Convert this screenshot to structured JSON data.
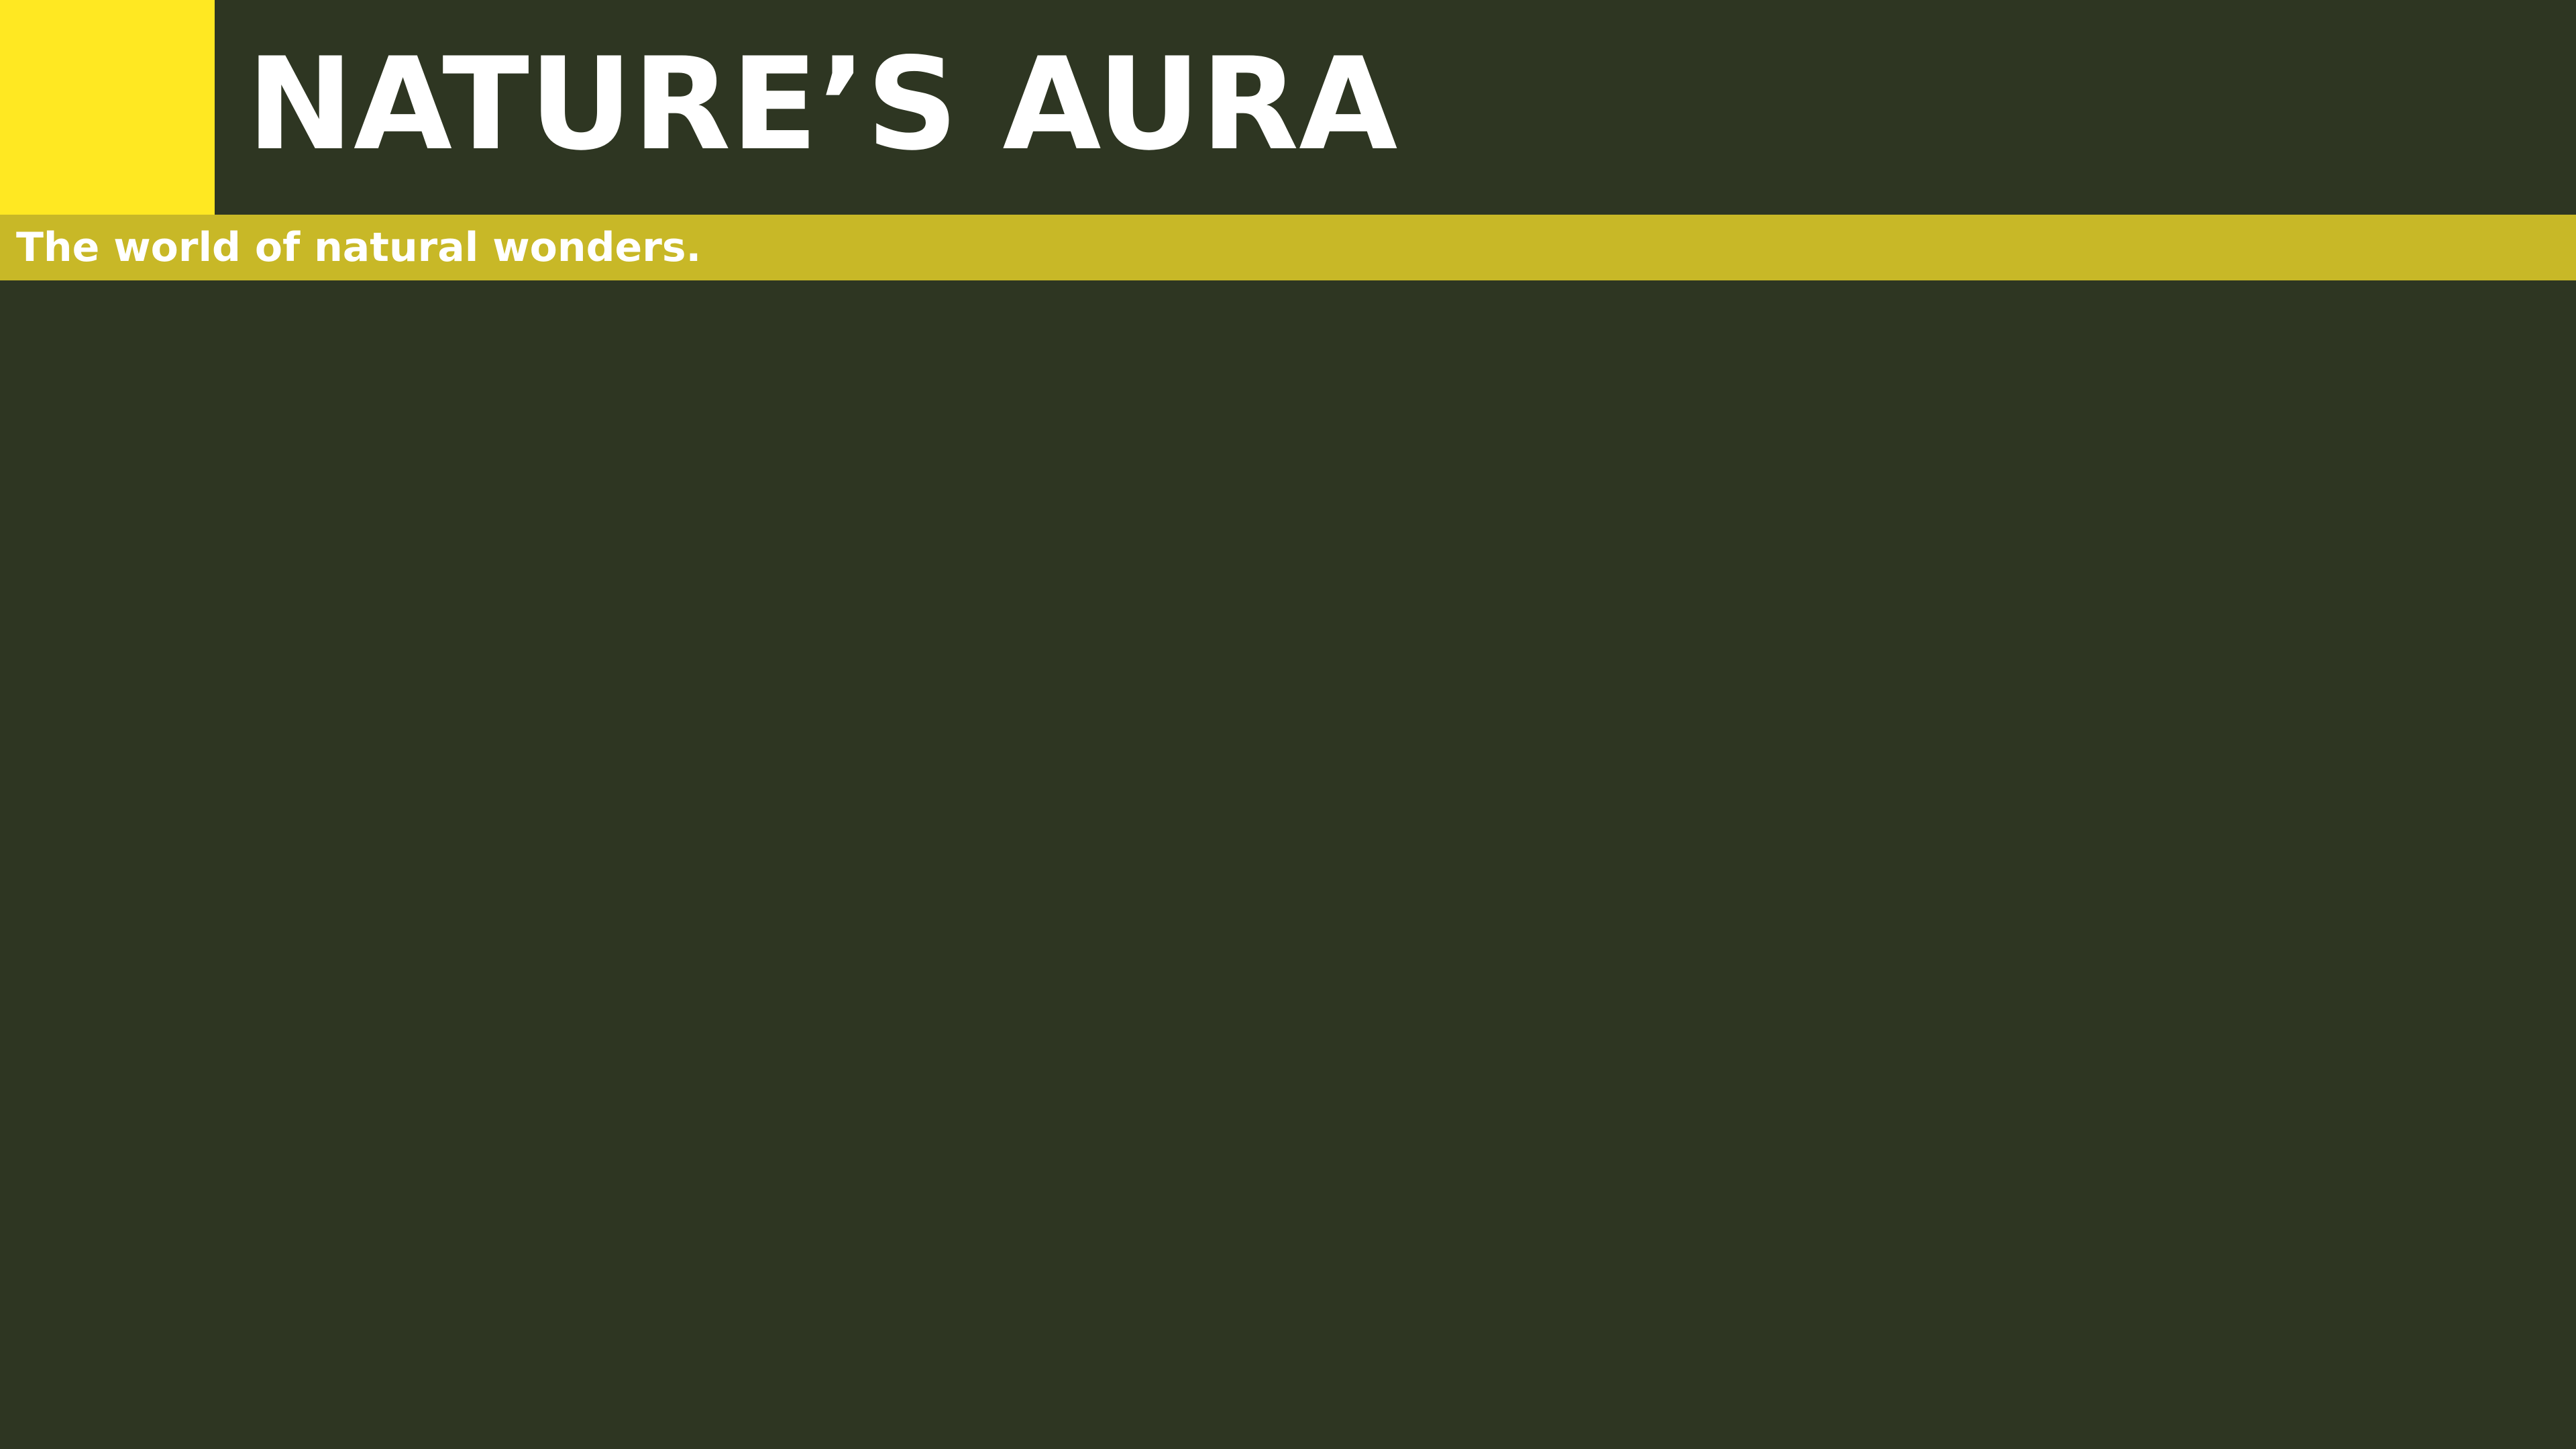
{
  "header": {
    "title": "NATURE’S AURA"
  },
  "tagline": {
    "text": "The world of natural wonders."
  },
  "colors": {
    "background": "#2e3622",
    "brand_yellow": "#ffe822",
    "tagline_bar": "#c8b827",
    "text": "#ffffff"
  }
}
